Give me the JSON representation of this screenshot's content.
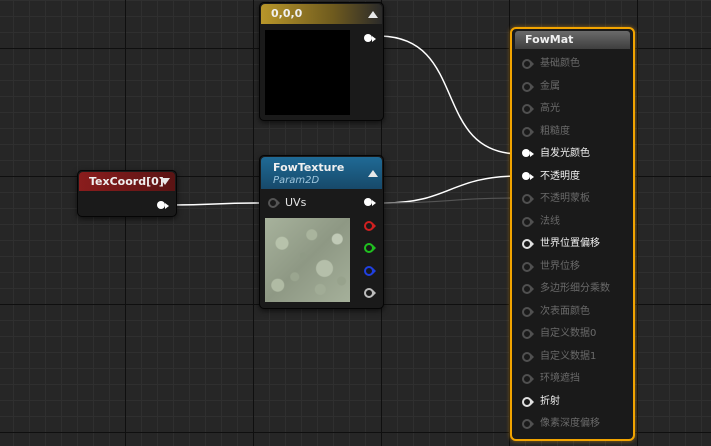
{
  "constant_node": {
    "title": "0,0,0",
    "header_color": "#b8962a"
  },
  "texcoord_node": {
    "title": "TexCoord[0]",
    "header_color": "#8a1d1d"
  },
  "texture_node": {
    "title": "FowTexture",
    "subtitle": "Param2D",
    "input_label": "UVs",
    "header_color": "#1d5f8a"
  },
  "material_node": {
    "title": "FowMat",
    "border_color": "#f2a400",
    "inputs": [
      {
        "label": "基础颜色",
        "state": "disabled"
      },
      {
        "label": "金属",
        "state": "disabled"
      },
      {
        "label": "高光",
        "state": "disabled"
      },
      {
        "label": "粗糙度",
        "state": "disabled"
      },
      {
        "label": "自发光颜色",
        "state": "connected"
      },
      {
        "label": "不透明度",
        "state": "connected"
      },
      {
        "label": "不透明蒙板",
        "state": "disabled"
      },
      {
        "label": "法线",
        "state": "disabled"
      },
      {
        "label": "世界位置偏移",
        "state": "active"
      },
      {
        "label": "世界位移",
        "state": "disabled"
      },
      {
        "label": "多边形细分乘数",
        "state": "disabled"
      },
      {
        "label": "次表面颜色",
        "state": "disabled"
      },
      {
        "label": "自定义数据0",
        "state": "disabled"
      },
      {
        "label": "自定义数据1",
        "state": "disabled"
      },
      {
        "label": "环境遮挡",
        "state": "disabled"
      },
      {
        "label": "折射",
        "state": "active"
      },
      {
        "label": "像素深度偏移",
        "state": "disabled"
      }
    ]
  },
  "icons": {
    "collapse": "collapse-arrow-icon",
    "dropdown": "dropdown-arrow-icon",
    "pin": "pin-icon"
  }
}
